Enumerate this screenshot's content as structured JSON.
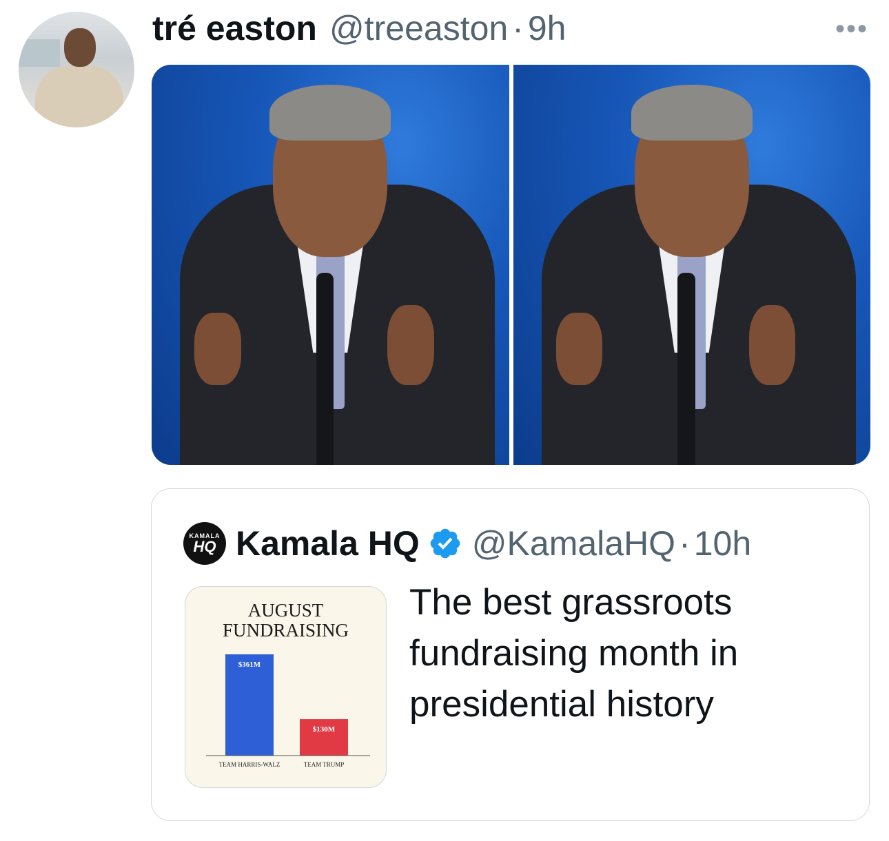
{
  "tweet": {
    "author_name": "tré easton",
    "author_handle": "@treeaston",
    "separator": "·",
    "time": "9h",
    "more_label": "•••"
  },
  "quote": {
    "logo_top": "KAMALA",
    "logo_bottom": "HQ",
    "author_name": "Kamala HQ",
    "author_handle": "@KamalaHQ",
    "separator": "·",
    "time": "10h",
    "text": "The best grassroots fundraising month in presidential history"
  },
  "colors": {
    "verified": "#1d9bf0",
    "text_primary": "#0f1419",
    "text_secondary": "#536471",
    "bar_blue": "#2e5fd6",
    "bar_red": "#e23a45"
  },
  "chart_data": {
    "type": "bar",
    "title": "AUGUST FUNDRAISING",
    "title_lines": [
      "AUGUST",
      "FUNDRAISING"
    ],
    "categories": [
      "TEAM HARRIS-WALZ",
      "TEAM TRUMP"
    ],
    "values": [
      361,
      130
    ],
    "value_labels": [
      "$361M",
      "$130M"
    ],
    "colors": [
      "#2e5fd6",
      "#e23a45"
    ],
    "ylim": [
      0,
      361
    ],
    "grid": false
  }
}
